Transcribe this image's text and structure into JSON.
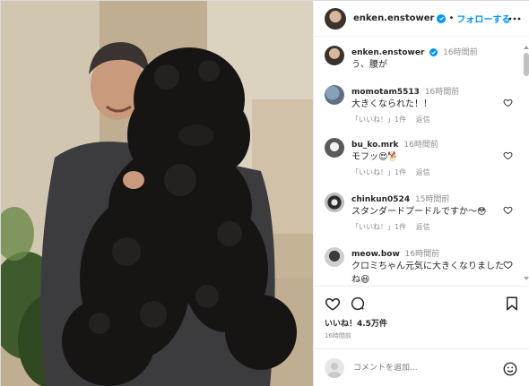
{
  "post": {
    "username": "enken.enstower",
    "follow_label": "フォローする",
    "caption": "う、腰が",
    "caption_time": "16時間前",
    "likes": "いいね！4.5万件",
    "posted": "16時間前",
    "comment_placeholder": "コメントを追加..."
  },
  "comments": [
    {
      "user": "momotam5513",
      "time": "16時間前",
      "text": "大きくなられた！！",
      "likes": "「いいね！」1件",
      "reply": "返信"
    },
    {
      "user": "bu_ko.mrk",
      "time": "16時間前",
      "text": "モフッ😍🐕",
      "likes": "「いいね！」1件",
      "reply": "返信"
    },
    {
      "user": "chinkun0524",
      "time": "15時間前",
      "text": "スタンダードプードルですか〜😳",
      "likes": "「いいね！」1件",
      "reply": "返信"
    },
    {
      "user": "meow.bow",
      "time": "16時間前",
      "text": "クロミちゃん元気に大きくなりましたね😆",
      "likes": "",
      "reply": ""
    }
  ],
  "icons": {
    "verified": "verified-badge-icon",
    "more": "more-options-icon",
    "like": "heart-icon",
    "comment": "comment-icon",
    "bookmark": "bookmark-icon",
    "emoji": "emoji-icon"
  },
  "colors": {
    "accent": "#0095f6",
    "text": "#262626",
    "muted": "#8e8e8e",
    "border": "#efefef"
  }
}
